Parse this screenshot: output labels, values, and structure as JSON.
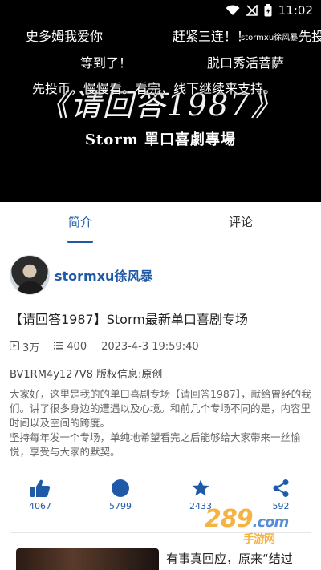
{
  "status_bar": {
    "time": "11:02"
  },
  "video": {
    "title_big": "《请回答1987》",
    "title_sub": "Storm 單口喜劇專場",
    "danmaku": [
      {
        "text": "史多姆我爱你",
        "small": false
      },
      {
        "text": "赶紧三连！！",
        "small": false
      },
      {
        "text": "stormxu徐风暴",
        "small": true
      },
      {
        "text": "先投",
        "small": false
      },
      {
        "text": "等到了！",
        "small": false
      },
      {
        "text": "脱口秀活菩萨",
        "small": false
      },
      {
        "text": "先投币，慢慢看。看完，线下继续来支持。",
        "small": false
      }
    ]
  },
  "tabs": [
    {
      "label": "简介",
      "active": true
    },
    {
      "label": "评论",
      "active": false
    }
  ],
  "author": {
    "name": "stormxu徐风暴"
  },
  "video_title": "【请回答1987】Storm最新单口喜剧专场",
  "meta": {
    "views": "3万",
    "danmaku_count": "400",
    "date": "2023-4-3 19:59:40"
  },
  "bvid_line": "BV1RM4y127V8 版权信息:原创",
  "description": "大家好，这里是我的的单口喜剧专场【请回答1987】，献给曾经的我们。讲了很多身边的遭遇以及心境。和前几个专场不同的是，内容里时间以及空间的跨度。\n坚持每年发一个专场，单纯地希望看完之后能够给大家带来一丝愉悦，享受与大家的默契。",
  "actions": [
    {
      "name": "like",
      "icon": "thumbs-up-icon",
      "count": "4067"
    },
    {
      "name": "coin",
      "icon": "coin-icon",
      "count": "5799"
    },
    {
      "name": "favorite",
      "icon": "star-icon",
      "count": "2433"
    },
    {
      "name": "share",
      "icon": "share-icon",
      "count": "592"
    }
  ],
  "recommend": {
    "title": "有事真回应，原来“结过"
  },
  "watermark": {
    "main": "289",
    "suffix": ".com",
    "sub": "手游网"
  },
  "colors": {
    "accent": "#1e5aa8",
    "watermark": "#f3a622"
  }
}
